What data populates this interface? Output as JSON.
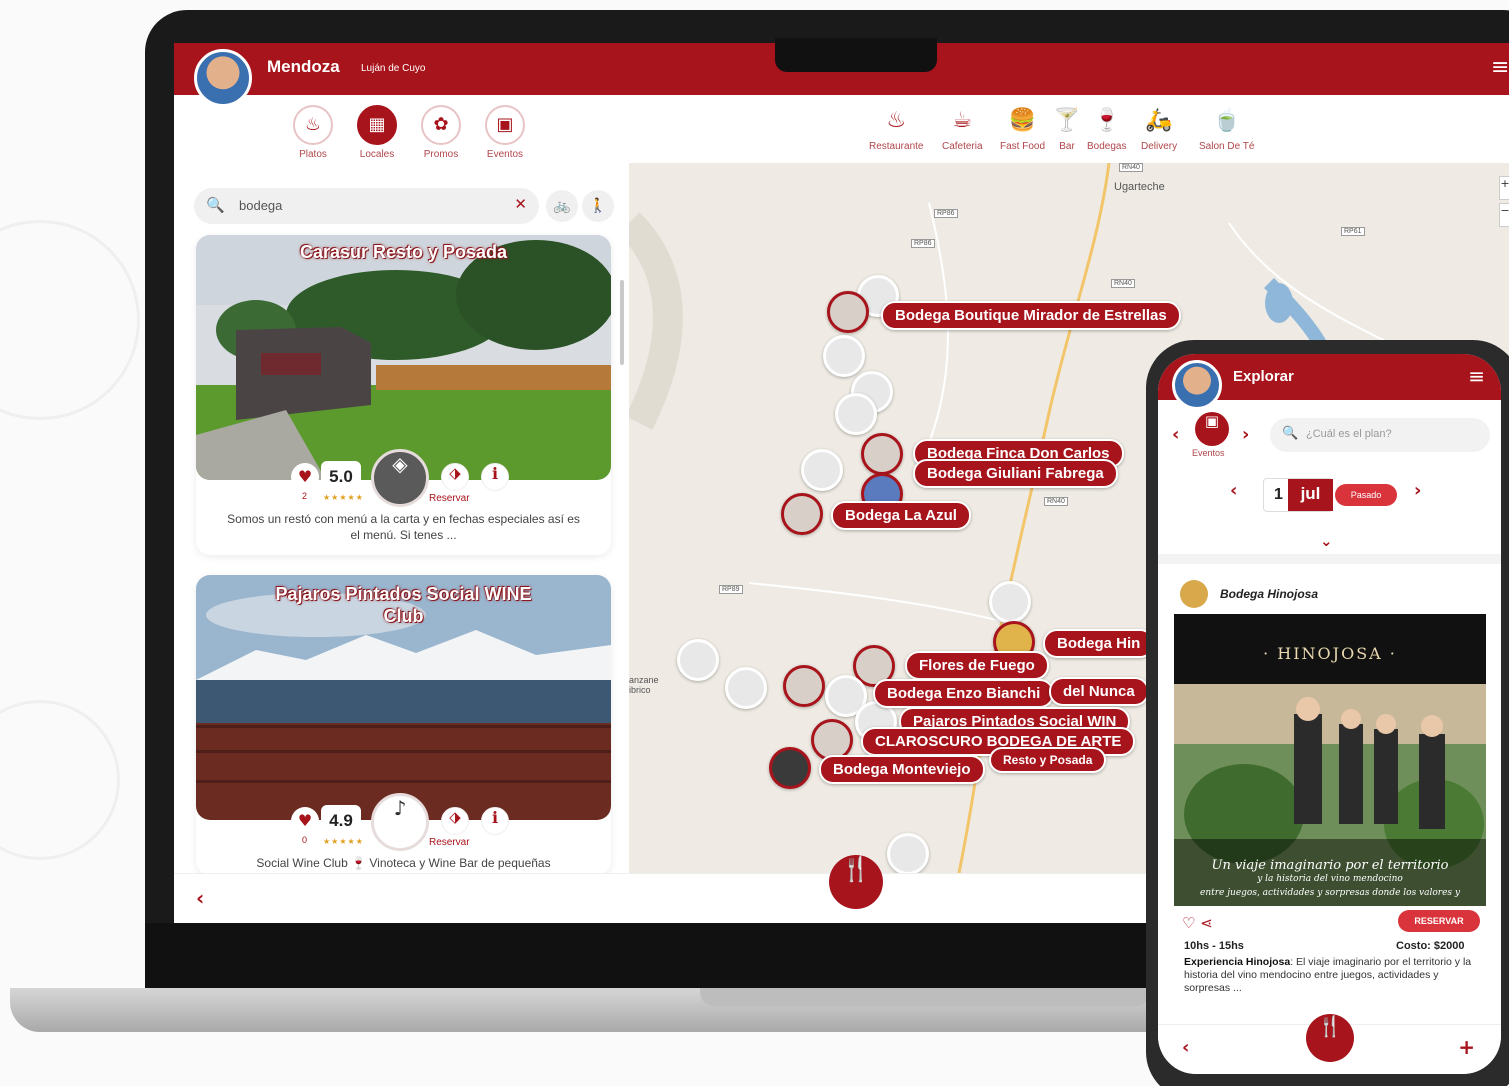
{
  "desktop": {
    "header": {
      "city": "Mendoza",
      "subtitle": "Luján de Cuyo",
      "menu_icon": "≡"
    },
    "tabs": [
      {
        "label": "Platos",
        "icon": "♨"
      },
      {
        "label": "Locales",
        "icon": "▦"
      },
      {
        "label": "Promos",
        "icon": "✿"
      },
      {
        "label": "Eventos",
        "icon": "▣"
      }
    ],
    "active_tab": "Locales",
    "search": {
      "value": "bodega",
      "icon": "🔍",
      "clear_icon": "✕",
      "bike_icon": "🚲",
      "walk_icon": "🚶"
    },
    "cards": [
      {
        "title": "Carasur Resto y Posada",
        "likes": "2",
        "rating": "5.0",
        "stars": "★★★★★",
        "reservar_label": "Reservar",
        "description": "Somos un restó con menú a la carta y en fechas especiales así es el menú. Si tenes ..."
      },
      {
        "title": "Pajaros Pintados Social WINE Club",
        "likes": "0",
        "rating": "4.9",
        "stars": "★★★★★",
        "reservar_label": "Reservar",
        "description": "Social Wine Club 🍷 Vinoteca y Wine Bar de pequeñas"
      }
    ],
    "map_categories": [
      {
        "label": "Restaurante",
        "icon": "♨"
      },
      {
        "label": "Cafeteria",
        "icon": "☕"
      },
      {
        "label": "Fast Food",
        "icon": "🍔"
      },
      {
        "label": "Bar",
        "icon": "🍸"
      },
      {
        "label": "Bodegas",
        "icon": "🍷"
      },
      {
        "label": "Delivery",
        "icon": "🛵"
      },
      {
        "label": "Salon De Té",
        "icon": "🍵"
      }
    ],
    "map": {
      "town": "Ugarteche",
      "town2": "anzane ibrico",
      "roads": [
        "RN40",
        "RP86",
        "RP86",
        "RN40",
        "RP61",
        "RN40",
        "RP89"
      ],
      "pins": [
        "Bodega Boutique Mirador de Estrellas",
        "Bodega Finca Don Carlos",
        "Bodega Giuliani Fabrega",
        "Bodega La Azul",
        "Bodega Hin",
        "Flores de Fuego",
        "Bodega Enzo Bianchi",
        "del Nunca",
        "Pajaros Pintados Social WIN",
        "CLAROSCURO BODEGA DE ARTE",
        "Resto y Posada",
        "Bodega Monteviejo"
      ]
    },
    "back_icon": "‹",
    "fab_icon": "🍴"
  },
  "phone": {
    "title": "Explorar",
    "menu_icon": "≡",
    "events_label": "Eventos",
    "search_placeholder": "¿Cuál es el plan?",
    "date": {
      "day": "1",
      "month": "jul",
      "status": "Pasado"
    },
    "event": {
      "venue": "Bodega Hinojosa",
      "brand": "· HINOJOSA ·",
      "caption": "Un viaje imaginario por el territorio",
      "caption2": "y la historia del vino mendocino",
      "caption3": "entre juegos, actividades y sorpresas donde los valores y",
      "reservar_label": "RESERVAR",
      "hours": "10hs - 15hs",
      "cost": "Costo: $2000",
      "desc_title": "Experiencia Hinojosa",
      "desc": ": El viaje imaginario por el territorio y la historia del vino mendocino entre juegos, actividades y sorpresas ..."
    },
    "back_icon": "‹",
    "plus_icon": "+",
    "fab_icon": "🍴"
  }
}
